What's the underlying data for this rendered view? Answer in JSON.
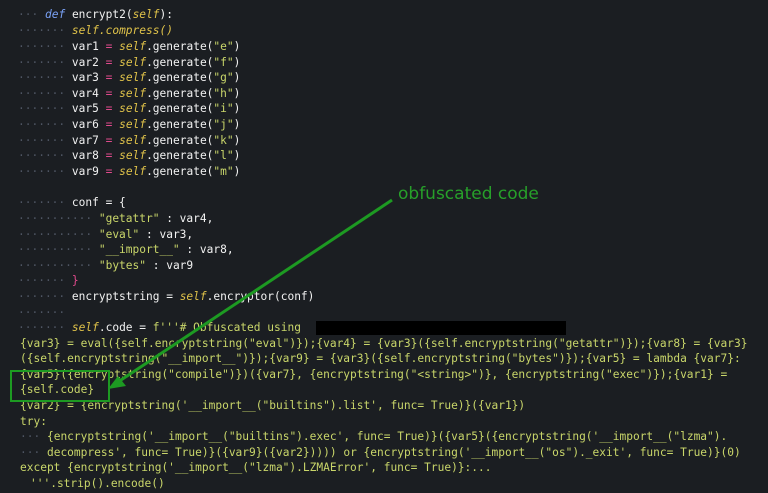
{
  "code": {
    "def_kw": "def",
    "def_name": "encrypt2(",
    "def_self": "self",
    "def_end": "):",
    "compress": ".compress()",
    "vars": [
      {
        "name": "var1",
        "arg": "\"e\""
      },
      {
        "name": "var2",
        "arg": "\"f\""
      },
      {
        "name": "var3",
        "arg": "\"g\""
      },
      {
        "name": "var4",
        "arg": "\"h\""
      },
      {
        "name": "var5",
        "arg": "\"i\""
      },
      {
        "name": "var6",
        "arg": "\"j\""
      },
      {
        "name": "var7",
        "arg": "\"k\""
      },
      {
        "name": "var8",
        "arg": "\"l\""
      },
      {
        "name": "var9",
        "arg": "\"m\""
      }
    ],
    "generate": ".generate(",
    "conf_open": "conf = {",
    "conf_items": [
      {
        "key": "\"getattr\"",
        "val": " : var4,"
      },
      {
        "key": "\"eval\"",
        "val": " : var3,"
      },
      {
        "key": "\"__import__\"",
        "val": " : var8,"
      },
      {
        "key": "\"bytes\"",
        "val": " : var9"
      }
    ],
    "conf_close": "}",
    "encrypt_line": "encryptstring = ",
    "encrypt_call": ".encryptor(conf)",
    "code_assign": ".code = ",
    "code_fstring": "f'''# Obfuscated using",
    "line_a": "{var3} = eval({self.encryptstring(\"eval\")});{var4} = {var3}({self.encryptstring(\"getattr\")});{var8} = {var3}",
    "line_b": "({self.encryptstring(\"__import__\")});{var9} = {var3}({self.encryptstring(\"bytes\")});{var5} = lambda {var7}:",
    "line_c": "{var5}({encryptstring(\"compile\")})({var7}, {encryptstring(\"<string>\")}, {encryptstring(\"exec\")});{var1} =",
    "line_d": "{self.code}",
    "line_e": "{var2} = {encryptstring('__import__(\"builtins\").list', func= True)}({var1})",
    "line_try": "try:",
    "line_f": "{encryptstring('__import__(\"builtins\").exec', func= True)}({var5}({encryptstring('__import__(\"lzma\").",
    "line_g": "decompress', func= True)}({var9}({var2})))) or {encryptstring('__import__(\"os\")._exit', func= True)}(0)",
    "line_h": "except {encryptstring('__import__(\"lzma\").LZMAError', func= True)}:...",
    "line_i": "'''.strip().encode()"
  },
  "annotation": {
    "label": "obfuscated code",
    "color": "#27a02a"
  }
}
